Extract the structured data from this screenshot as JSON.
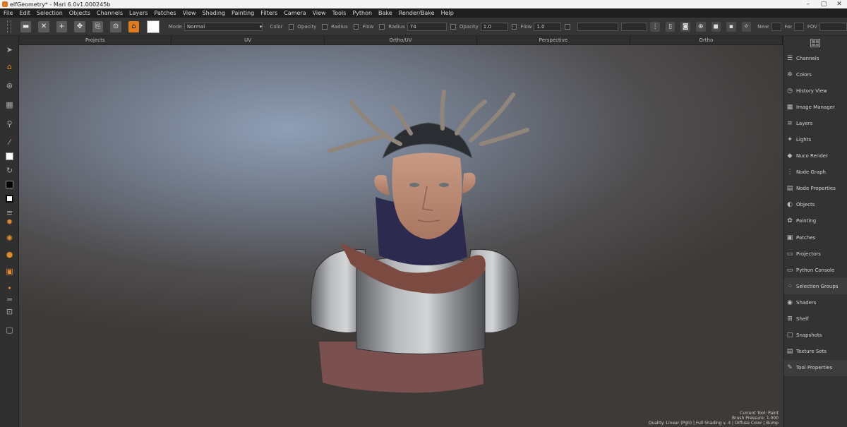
{
  "window": {
    "title": "elfGeometry* - Mari 6.0v1.000245b",
    "minimize": "–",
    "maximize": "▢",
    "close": "✕"
  },
  "menu": [
    "File",
    "Edit",
    "Selection",
    "Objects",
    "Channels",
    "Layers",
    "Patches",
    "View",
    "Shading",
    "Painting",
    "Filters",
    "Camera",
    "View",
    "Tools",
    "Python",
    "Bake",
    "Render/Bake",
    "Help"
  ],
  "toolbar": {
    "mode_label": "Mode",
    "mode_value": "Normal",
    "color_label": "Color",
    "opacity_label": "Opacity",
    "radius_label": "Radius",
    "flow_label": "Flow",
    "radius2_label": "Radius",
    "radius_value": "74",
    "opacity2_label": "Opacity",
    "opacity_value": "1.0",
    "flow2_label": "Flow",
    "flow_value": "1.0",
    "near_label": "Near",
    "far_label": "Far",
    "fov_label": "FOV"
  },
  "view_tabs": [
    "Projects",
    "UV",
    "Ortho/UV",
    "Perspective",
    "Ortho"
  ],
  "right_panel": [
    {
      "label": "Channels",
      "icon": "channels-icon",
      "glyph": "☰"
    },
    {
      "label": "Colors",
      "icon": "colors-icon",
      "glyph": "✲"
    },
    {
      "label": "History View",
      "icon": "history-icon",
      "glyph": "◷"
    },
    {
      "label": "Image Manager",
      "icon": "image-manager-icon",
      "glyph": "▦"
    },
    {
      "label": "Layers",
      "icon": "layers-icon",
      "glyph": "≡"
    },
    {
      "label": "Lights",
      "icon": "lights-icon",
      "glyph": "✦"
    },
    {
      "label": "Nuco Render",
      "icon": "render-icon",
      "glyph": "◆"
    },
    {
      "label": "Node Graph",
      "icon": "node-graph-icon",
      "glyph": "⋮"
    },
    {
      "label": "Node Properties",
      "icon": "node-properties-icon",
      "glyph": "▤"
    },
    {
      "label": "Objects",
      "icon": "objects-icon",
      "glyph": "◐"
    },
    {
      "label": "Painting",
      "icon": "painting-icon",
      "glyph": "✿"
    },
    {
      "label": "Patches",
      "icon": "patches-icon",
      "glyph": "▣"
    },
    {
      "label": "Projectors",
      "icon": "projectors-icon",
      "glyph": "▭"
    },
    {
      "label": "Python Console",
      "icon": "python-console-icon",
      "glyph": "▭"
    },
    {
      "label": "Selection Groups",
      "icon": "selection-groups-icon",
      "glyph": "⁘"
    },
    {
      "label": "Shaders",
      "icon": "shaders-icon",
      "glyph": "◉"
    },
    {
      "label": "Shelf",
      "icon": "shelf-icon",
      "glyph": "⊞"
    },
    {
      "label": "Snapshots",
      "icon": "snapshots-icon",
      "glyph": "□"
    },
    {
      "label": "Texture Sets",
      "icon": "texture-sets-icon",
      "glyph": "▤"
    },
    {
      "label": "Tool Properties",
      "icon": "tool-properties-icon",
      "glyph": "✎"
    }
  ],
  "hud": {
    "line1": "Current Tool: Paint",
    "line2": "Brush Pressure: 1.000",
    "line3": "Quality: Linear (Pgh) | Full Shading v. 4 | Diffuse Color | Bump"
  },
  "colors": {
    "accent": "#e07a1f",
    "fg_swatch": "#ffffff",
    "bg_swatch": "#000000"
  }
}
